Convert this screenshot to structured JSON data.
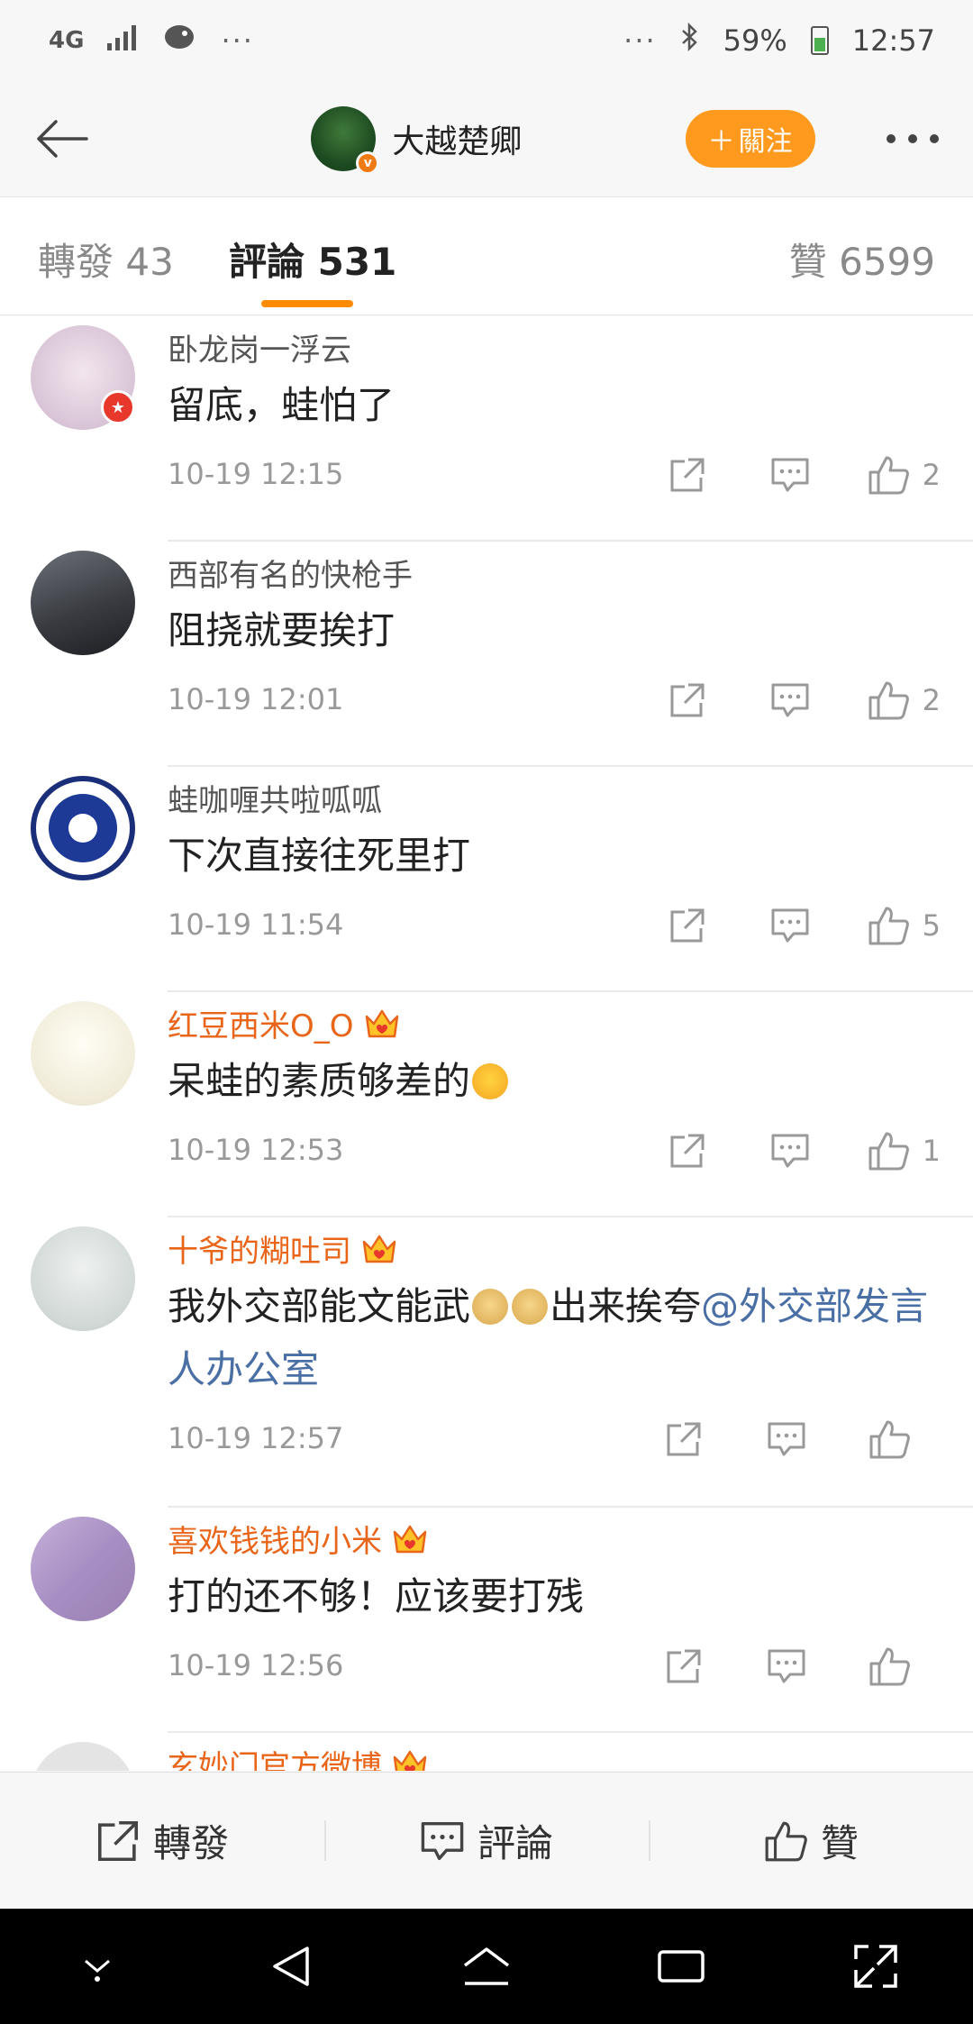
{
  "status_bar": {
    "network": "4G",
    "time": "12:57",
    "battery": "59%",
    "dots_left": "···",
    "dots_right": "···"
  },
  "header": {
    "user_name": "大越楚卿",
    "verified_badge": "v",
    "follow_label": "關注",
    "follow_plus": "＋"
  },
  "tabs": {
    "repost": "轉發 43",
    "comments": "評論 531",
    "likes": "贊 6599"
  },
  "comments": [
    {
      "user": "卧龙岗一浮云",
      "text": "留底，蛙怕了",
      "time": "10-19 12:15",
      "likes": "2"
    },
    {
      "user": "西部有名的快枪手",
      "text": "阻挠就要挨打",
      "time": "10-19 12:01",
      "likes": "2"
    },
    {
      "user": "蛙咖喱共啦呱呱",
      "text": "下次直接往死里打",
      "time": "10-19 11:54",
      "likes": "5"
    },
    {
      "user": "红豆西米O_O",
      "text": "呆蛙的素质够差的",
      "time": "10-19 12:53",
      "likes": "1"
    },
    {
      "user": "十爷的糊吐司",
      "text_before": "我外交部能文能武",
      "text_after": "出来挨夸",
      "mention": "@外交部发言人办公室",
      "time": "10-19 12:57",
      "likes": ""
    },
    {
      "user": "喜欢钱钱的小米",
      "text": "打的还不够！应该要打残",
      "time": "10-19 12:56",
      "likes": ""
    },
    {
      "user": "玄妙门官方微博",
      "text": "",
      "time": "",
      "likes": ""
    }
  ],
  "bottom_bar": {
    "repost": "轉發",
    "comment": "評論",
    "like": "贊"
  },
  "colors": {
    "accent": "#ff9a1e",
    "tab_underline": "#ff8c00",
    "vip_name": "#e8651a",
    "mention": "#4a6fa5"
  }
}
